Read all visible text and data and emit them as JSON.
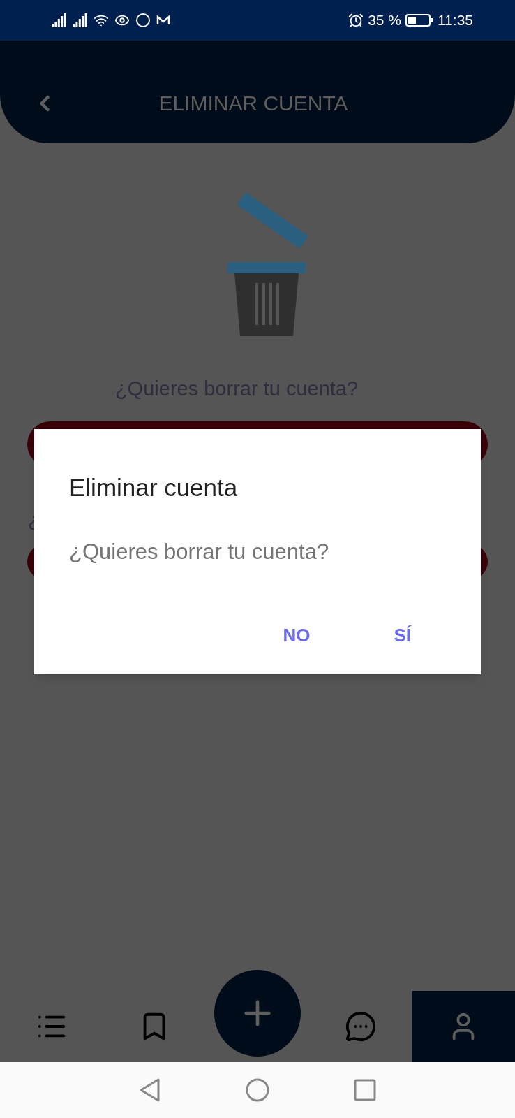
{
  "status_bar": {
    "battery": "35 %",
    "time": "11:35"
  },
  "header": {
    "title": "ELIMINAR CUENTA"
  },
  "page": {
    "prompt": "¿Quieres borrar tu cuenta?",
    "partial_text": "¿"
  },
  "dialog": {
    "title": "Eliminar cuenta",
    "message": "¿Quieres borrar tu cuenta?",
    "buttons": [
      "NO",
      "SÍ"
    ]
  },
  "bottom_nav": [
    {
      "kind": "list",
      "selected": false
    },
    {
      "kind": "bookmark",
      "selected": false
    },
    {
      "kind": "add",
      "selected": false
    },
    {
      "kind": "chat",
      "selected": false
    },
    {
      "kind": "profile",
      "selected": true
    }
  ]
}
